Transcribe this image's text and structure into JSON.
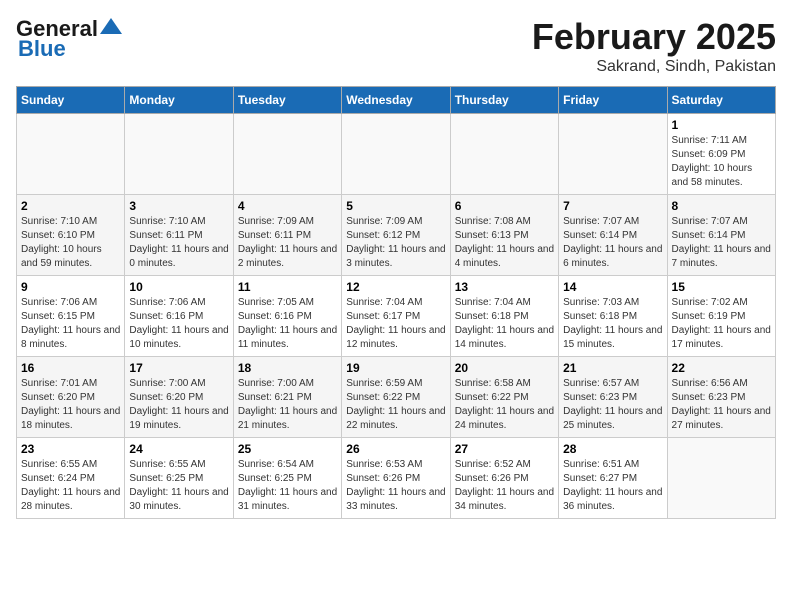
{
  "header": {
    "logo_general": "General",
    "logo_blue": "Blue",
    "month": "February 2025",
    "location": "Sakrand, Sindh, Pakistan"
  },
  "days_of_week": [
    "Sunday",
    "Monday",
    "Tuesday",
    "Wednesday",
    "Thursday",
    "Friday",
    "Saturday"
  ],
  "weeks": [
    [
      {
        "day": "",
        "info": ""
      },
      {
        "day": "",
        "info": ""
      },
      {
        "day": "",
        "info": ""
      },
      {
        "day": "",
        "info": ""
      },
      {
        "day": "",
        "info": ""
      },
      {
        "day": "",
        "info": ""
      },
      {
        "day": "1",
        "info": "Sunrise: 7:11 AM\nSunset: 6:09 PM\nDaylight: 10 hours and 58 minutes."
      }
    ],
    [
      {
        "day": "2",
        "info": "Sunrise: 7:10 AM\nSunset: 6:10 PM\nDaylight: 10 hours and 59 minutes."
      },
      {
        "day": "3",
        "info": "Sunrise: 7:10 AM\nSunset: 6:11 PM\nDaylight: 11 hours and 0 minutes."
      },
      {
        "day": "4",
        "info": "Sunrise: 7:09 AM\nSunset: 6:11 PM\nDaylight: 11 hours and 2 minutes."
      },
      {
        "day": "5",
        "info": "Sunrise: 7:09 AM\nSunset: 6:12 PM\nDaylight: 11 hours and 3 minutes."
      },
      {
        "day": "6",
        "info": "Sunrise: 7:08 AM\nSunset: 6:13 PM\nDaylight: 11 hours and 4 minutes."
      },
      {
        "day": "7",
        "info": "Sunrise: 7:07 AM\nSunset: 6:14 PM\nDaylight: 11 hours and 6 minutes."
      },
      {
        "day": "8",
        "info": "Sunrise: 7:07 AM\nSunset: 6:14 PM\nDaylight: 11 hours and 7 minutes."
      }
    ],
    [
      {
        "day": "9",
        "info": "Sunrise: 7:06 AM\nSunset: 6:15 PM\nDaylight: 11 hours and 8 minutes."
      },
      {
        "day": "10",
        "info": "Sunrise: 7:06 AM\nSunset: 6:16 PM\nDaylight: 11 hours and 10 minutes."
      },
      {
        "day": "11",
        "info": "Sunrise: 7:05 AM\nSunset: 6:16 PM\nDaylight: 11 hours and 11 minutes."
      },
      {
        "day": "12",
        "info": "Sunrise: 7:04 AM\nSunset: 6:17 PM\nDaylight: 11 hours and 12 minutes."
      },
      {
        "day": "13",
        "info": "Sunrise: 7:04 AM\nSunset: 6:18 PM\nDaylight: 11 hours and 14 minutes."
      },
      {
        "day": "14",
        "info": "Sunrise: 7:03 AM\nSunset: 6:18 PM\nDaylight: 11 hours and 15 minutes."
      },
      {
        "day": "15",
        "info": "Sunrise: 7:02 AM\nSunset: 6:19 PM\nDaylight: 11 hours and 17 minutes."
      }
    ],
    [
      {
        "day": "16",
        "info": "Sunrise: 7:01 AM\nSunset: 6:20 PM\nDaylight: 11 hours and 18 minutes."
      },
      {
        "day": "17",
        "info": "Sunrise: 7:00 AM\nSunset: 6:20 PM\nDaylight: 11 hours and 19 minutes."
      },
      {
        "day": "18",
        "info": "Sunrise: 7:00 AM\nSunset: 6:21 PM\nDaylight: 11 hours and 21 minutes."
      },
      {
        "day": "19",
        "info": "Sunrise: 6:59 AM\nSunset: 6:22 PM\nDaylight: 11 hours and 22 minutes."
      },
      {
        "day": "20",
        "info": "Sunrise: 6:58 AM\nSunset: 6:22 PM\nDaylight: 11 hours and 24 minutes."
      },
      {
        "day": "21",
        "info": "Sunrise: 6:57 AM\nSunset: 6:23 PM\nDaylight: 11 hours and 25 minutes."
      },
      {
        "day": "22",
        "info": "Sunrise: 6:56 AM\nSunset: 6:23 PM\nDaylight: 11 hours and 27 minutes."
      }
    ],
    [
      {
        "day": "23",
        "info": "Sunrise: 6:55 AM\nSunset: 6:24 PM\nDaylight: 11 hours and 28 minutes."
      },
      {
        "day": "24",
        "info": "Sunrise: 6:55 AM\nSunset: 6:25 PM\nDaylight: 11 hours and 30 minutes."
      },
      {
        "day": "25",
        "info": "Sunrise: 6:54 AM\nSunset: 6:25 PM\nDaylight: 11 hours and 31 minutes."
      },
      {
        "day": "26",
        "info": "Sunrise: 6:53 AM\nSunset: 6:26 PM\nDaylight: 11 hours and 33 minutes."
      },
      {
        "day": "27",
        "info": "Sunrise: 6:52 AM\nSunset: 6:26 PM\nDaylight: 11 hours and 34 minutes."
      },
      {
        "day": "28",
        "info": "Sunrise: 6:51 AM\nSunset: 6:27 PM\nDaylight: 11 hours and 36 minutes."
      },
      {
        "day": "",
        "info": ""
      }
    ]
  ]
}
